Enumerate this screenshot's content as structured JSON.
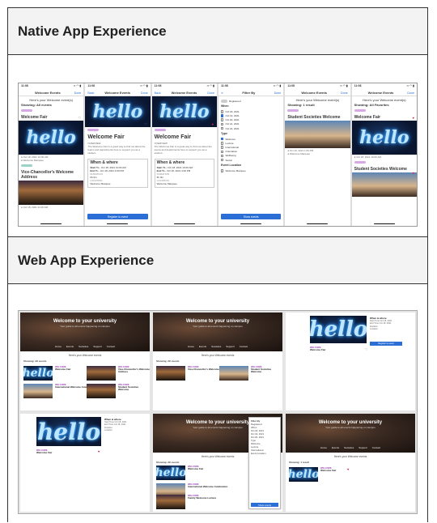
{
  "native_section": {
    "heading": "Native App Experience"
  },
  "web_section": {
    "heading": "Web App Experience"
  },
  "phone": {
    "time": "11:08",
    "list_title": "Welcome Events",
    "back": "Back",
    "done": "Done",
    "greeting": "Here's your Welcome event(s)",
    "showing_all": "Showing: All events",
    "showing_result": "Showing: 1 result",
    "showing_fav": "Showing: All Favorites",
    "event1": "Welcome Fair",
    "event2": "Vice-Chancellor's Welcome Address",
    "event3": "Student Societies Welcome",
    "hello": "hello",
    "when_where": "When & where",
    "register": "Register to event",
    "filter_by": "Filter By",
    "registered": "Registered",
    "when": "When",
    "dates": [
      "Oct 18, 2021",
      "Oct 19, 2021",
      "Oct 20, 2021",
      "Oct 21, 2021",
      "Oct 22, 2021"
    ],
    "type": "Type",
    "types": [
      "Welcome",
      "Lecture",
      "International",
      "Orientation",
      "Wellbeing",
      "Social"
    ],
    "event_location": "Event Location",
    "location": "Welcome Marquee",
    "show_events": "Show events",
    "start": "Start Ti...",
    "end": "End Ti...",
    "start_val": "Oct 18, 2021 10:00 AM",
    "end_val": "Oct 18, 2021 4:00 PM",
    "duration_label": "DURATION",
    "duration": "6h 0m",
    "location_label": "LOCATION",
    "overview_label": "OVERVIEW",
    "overview": "The Welcome Fair is a great way to find out about the teams and departments here to support you as a student.",
    "see_more": "Read more"
  },
  "web": {
    "banner_title": "Welcome to your university",
    "banner_sub": "Your guide to all events happening on campus",
    "tabs": [
      "Home",
      "Events",
      "Societies",
      "Support",
      "Contact"
    ],
    "list_heading": "Here's your Welcome events",
    "showing_all": "Showing: All events",
    "showing_result": "Showing: 1 result",
    "event1": "Welcome Fair",
    "event2": "Vice-Chancellor's Welcome Address",
    "event3": "International Welcome Celebration",
    "event4": "Student Societies Welcome",
    "event5": "Family Welcome Lecture",
    "when_where": "When & where",
    "register": "Register to event",
    "hello": "hello"
  }
}
